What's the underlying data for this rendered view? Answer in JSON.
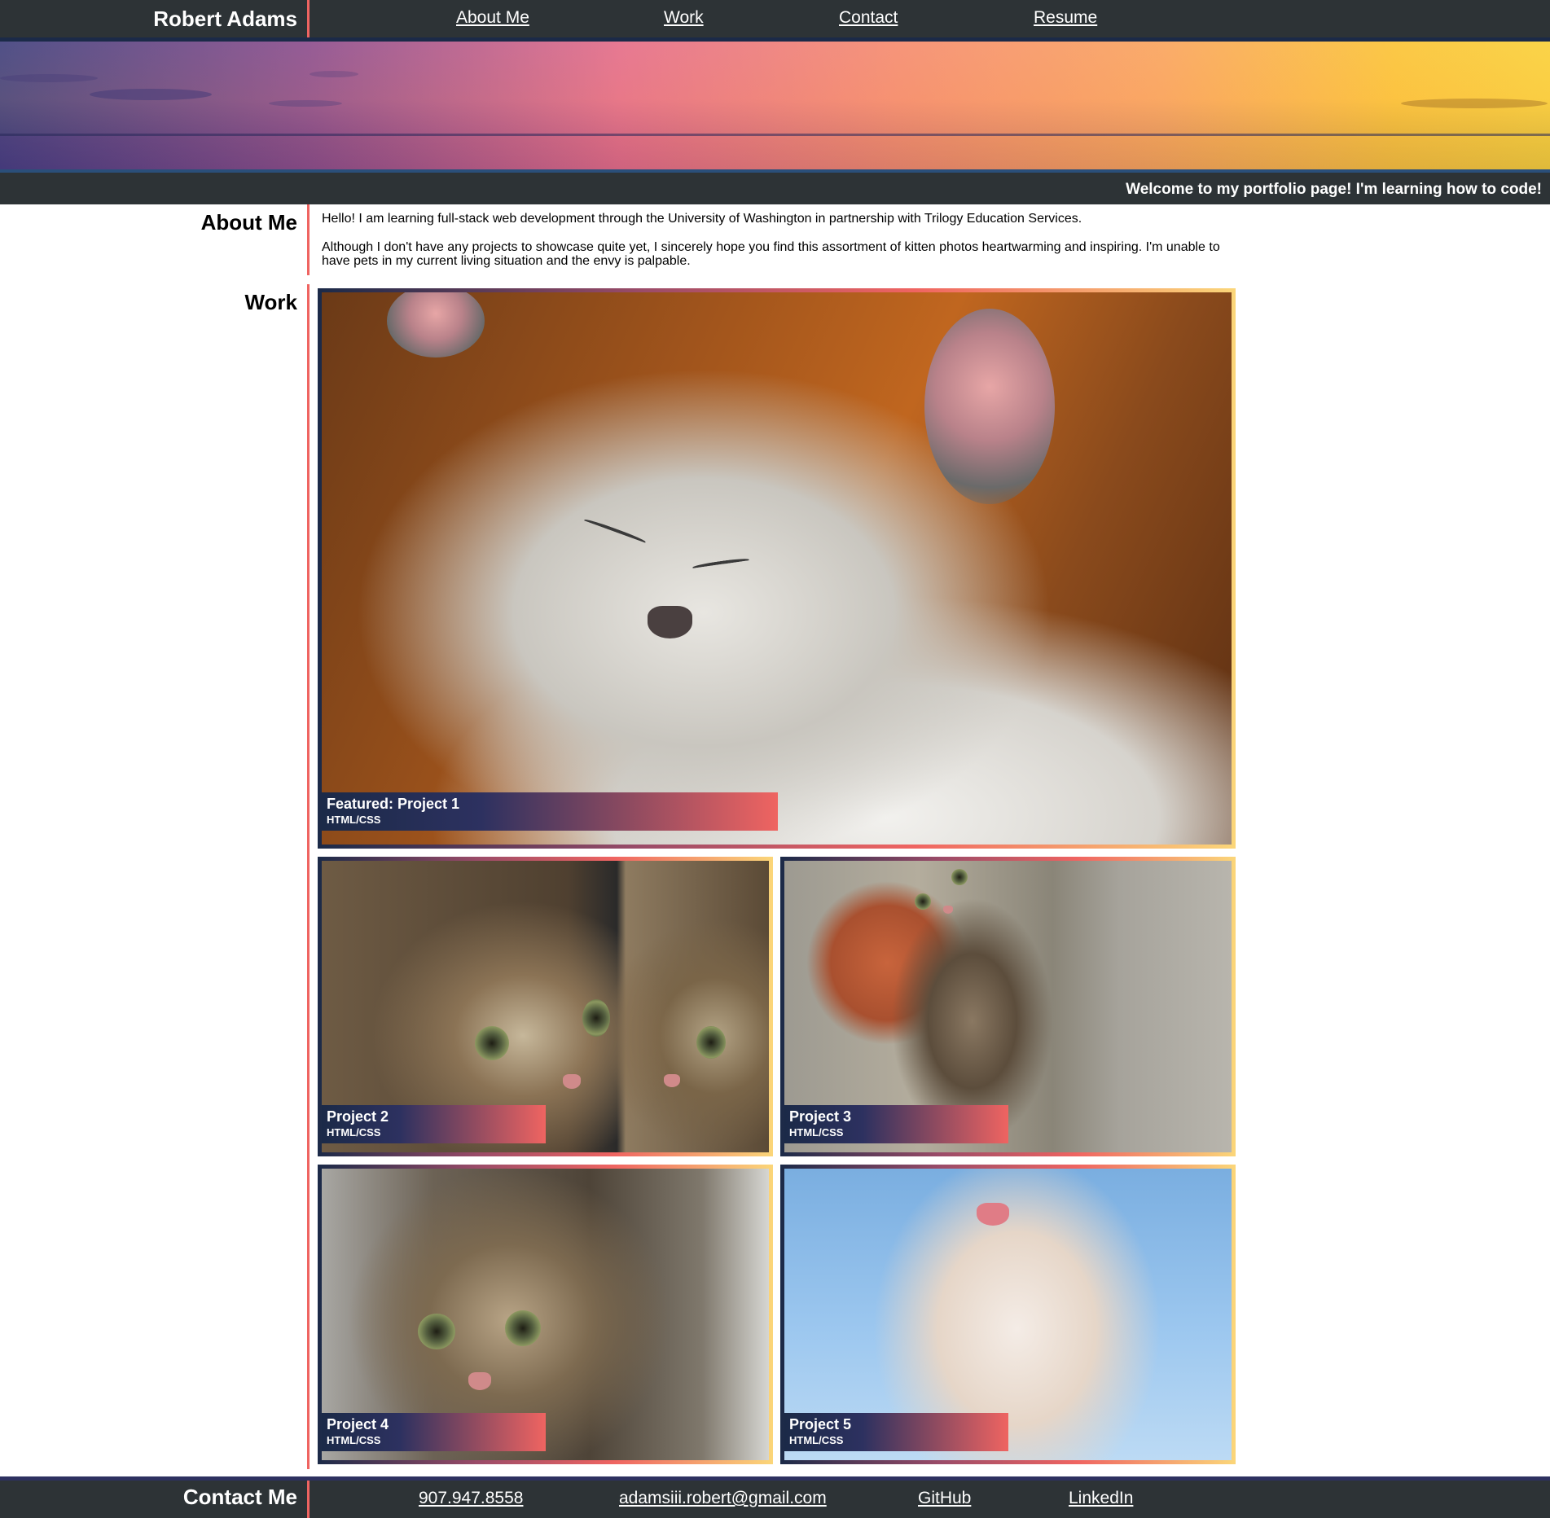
{
  "header": {
    "name": "Robert Adams",
    "nav": [
      "About Me",
      "Work",
      "Contact",
      "Resume"
    ]
  },
  "welcome": "Welcome to my portfolio page! I'm learning how to code!",
  "about": {
    "title": "About Me",
    "paragraphs": [
      "Hello! I am learning full-stack web development through the University of Washington in partnership with Trilogy Education Services.",
      "Although I don't have any projects to showcase quite yet, I sincerely hope you find this assortment of kitten photos heartwarming and inspiring. I'm unable to have pets in my current living situation and the envy is palpable."
    ]
  },
  "work": {
    "title": "Work",
    "projects": [
      {
        "title": "Featured: Project 1",
        "tech": "HTML/CSS"
      },
      {
        "title": "Project 2",
        "tech": "HTML/CSS"
      },
      {
        "title": "Project 3",
        "tech": "HTML/CSS"
      },
      {
        "title": "Project 4",
        "tech": "HTML/CSS"
      },
      {
        "title": "Project 5",
        "tech": "HTML/CSS"
      }
    ]
  },
  "contact": {
    "title": "Contact Me",
    "phone": "907.947.8558",
    "email": "adamsiii.robert@gmail.com",
    "github": "GitHub",
    "linkedin": "LinkedIn"
  },
  "colors": {
    "dark": "#2d3336",
    "navy": "#1b2a48",
    "coral": "#ef6461",
    "gold": "#fbd679"
  },
  "icons": [
    "banner-sunset-image",
    "kitten-photo"
  ]
}
